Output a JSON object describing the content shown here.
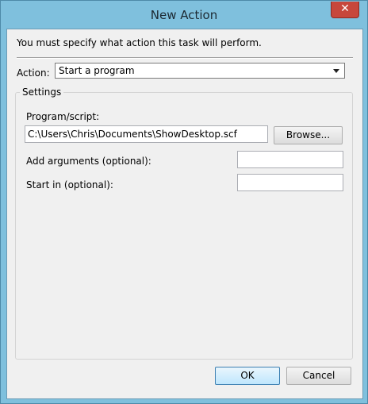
{
  "window": {
    "title": "New Action",
    "close_glyph": "✕"
  },
  "instruction": "You must specify what action this task will perform.",
  "action": {
    "label": "Action:",
    "value": "Start a program"
  },
  "settings": {
    "title": "Settings",
    "program_label": "Program/script:",
    "program_value": "C:\\Users\\Chris\\Documents\\ShowDesktop.scf",
    "browse_label": "Browse...",
    "arguments_label": "Add arguments (optional):",
    "arguments_value": "",
    "start_in_label": "Start in (optional):",
    "start_in_value": ""
  },
  "buttons": {
    "ok": "OK",
    "cancel": "Cancel"
  },
  "icons": {
    "close": "close-icon",
    "dropdown": "chevron-down-icon"
  }
}
